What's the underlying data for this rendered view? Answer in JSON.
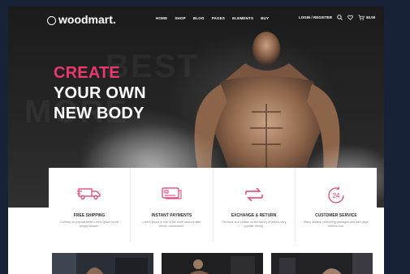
{
  "header": {
    "logo_text": "woodmart.",
    "nav": [
      "HOME",
      "SHOP",
      "BLOG",
      "PAGES",
      "ELEMENTS",
      "BUY"
    ],
    "login_label": "LOGIN / REGISTER",
    "cart_total": "$0.00",
    "icons": [
      "search-icon",
      "heart-icon",
      "cart-icon"
    ]
  },
  "hero": {
    "line1": "CREATE",
    "line2": "YOUR OWN",
    "line3": "NEW BODY"
  },
  "features": [
    {
      "icon": "truck-icon",
      "title": "FREE SHIPPING",
      "desc": "Contrary to popular belief Lorem Ipsum is not simply random."
    },
    {
      "icon": "card-icon",
      "title": "INSTANT PAYMENTS",
      "desc": "Lorem ipsum is one of the more obscure latin words, consectetur."
    },
    {
      "icon": "exchange-icon",
      "title": "EXCHANGE & RETURN",
      "desc": "The book is a treatise on the theory of ethics, very popular during."
    },
    {
      "icon": "support-24-icon",
      "title": "CUSTOMER SERVICE",
      "desc": "Many desktop publishing packages and web page editors now."
    }
  ],
  "colors": {
    "accent": "#e8386c",
    "page_bg": "#172236",
    "hero_bg": "#222222"
  }
}
